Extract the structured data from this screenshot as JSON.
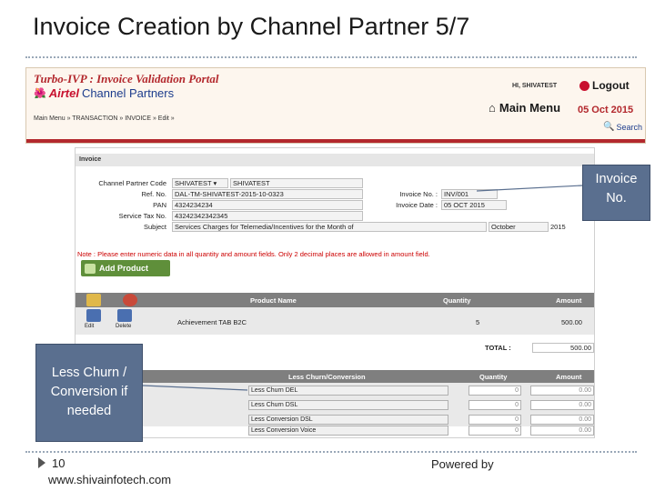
{
  "slide": {
    "title": "Invoice Creation by Channel Partner 5/7",
    "slide_number": "10",
    "website": "www.shivainfotech.com",
    "powered_by": "Powered by"
  },
  "portal": {
    "title": "Turbo-IVP : Invoice Validation Portal",
    "brand_airtel": "Airtel",
    "brand_rest": "Channel Partners",
    "breadcrumb": "Main Menu » TRANSACTION » INVOICE » Edit »",
    "hi_user": "HI, SHIVATEST",
    "logout_label": "Logout",
    "main_menu_label": "Main Menu",
    "date": "05 Oct 2015",
    "search_label": "Search"
  },
  "form": {
    "header": "Invoice",
    "fields": {
      "channel_partner_code_label": "Channel Partner Code",
      "channel_partner_code_value": "SHIVATEST",
      "channel_partner_name_value": "SHIVATEST",
      "ref_no_label": "Ref. No.",
      "ref_no_value": "DAL-TM-SHIVATEST-2015-10-0323",
      "pan_label": "PAN",
      "pan_value": "4324234234",
      "service_tax_label": "Service Tax No.",
      "service_tax_value": "43242342342345",
      "subject_label": "Subject",
      "subject_value": "Services Charges for Telemedia/Incentives for the Month of",
      "month_value": "October",
      "year_value": "2015",
      "invoice_no_label": "Invoice No. :",
      "invoice_no_value": "INV/001",
      "invoice_date_label": "Invoice Date :",
      "invoice_date_value": "05 OCT 2015"
    },
    "note": "Note : Please enter numeric data in all quantity and amount fields. Only 2 decimal places are allowed in amount field.",
    "add_product_label": "Add Product",
    "product_table": {
      "col_product": "Product Name",
      "col_quantity": "Quantity",
      "col_amount": "Amount",
      "edit_label": "Edit",
      "delete_label": "Delete",
      "rows": [
        {
          "product": "Achievement TAB B2C",
          "quantity": "5",
          "amount": "500.00"
        }
      ],
      "total_label": "TOTAL :",
      "total_value": "500.00"
    },
    "churn_table": {
      "col_name": "Less Churn/Conversion",
      "col_quantity": "Quantity",
      "col_amount": "Amount",
      "rows": [
        {
          "name": "Less Churn DEL",
          "quantity": "0",
          "amount": "0.00"
        },
        {
          "name": "Less Churn DSL",
          "quantity": "0",
          "amount": "0.00"
        },
        {
          "name": "Less Conversion DSL",
          "quantity": "0",
          "amount": "0.00"
        },
        {
          "name": "Less Conversion Voice",
          "quantity": "0",
          "amount": "0.00"
        }
      ]
    }
  },
  "callouts": {
    "invoice_no": [
      "Invoice",
      "No."
    ],
    "churn": [
      "Less Churn /",
      "Conversion if",
      "needed"
    ]
  },
  "colors": {
    "accent_red": "#b3282d",
    "callout_bg": "#5a6f8f",
    "button_green": "#5f8f3a"
  }
}
